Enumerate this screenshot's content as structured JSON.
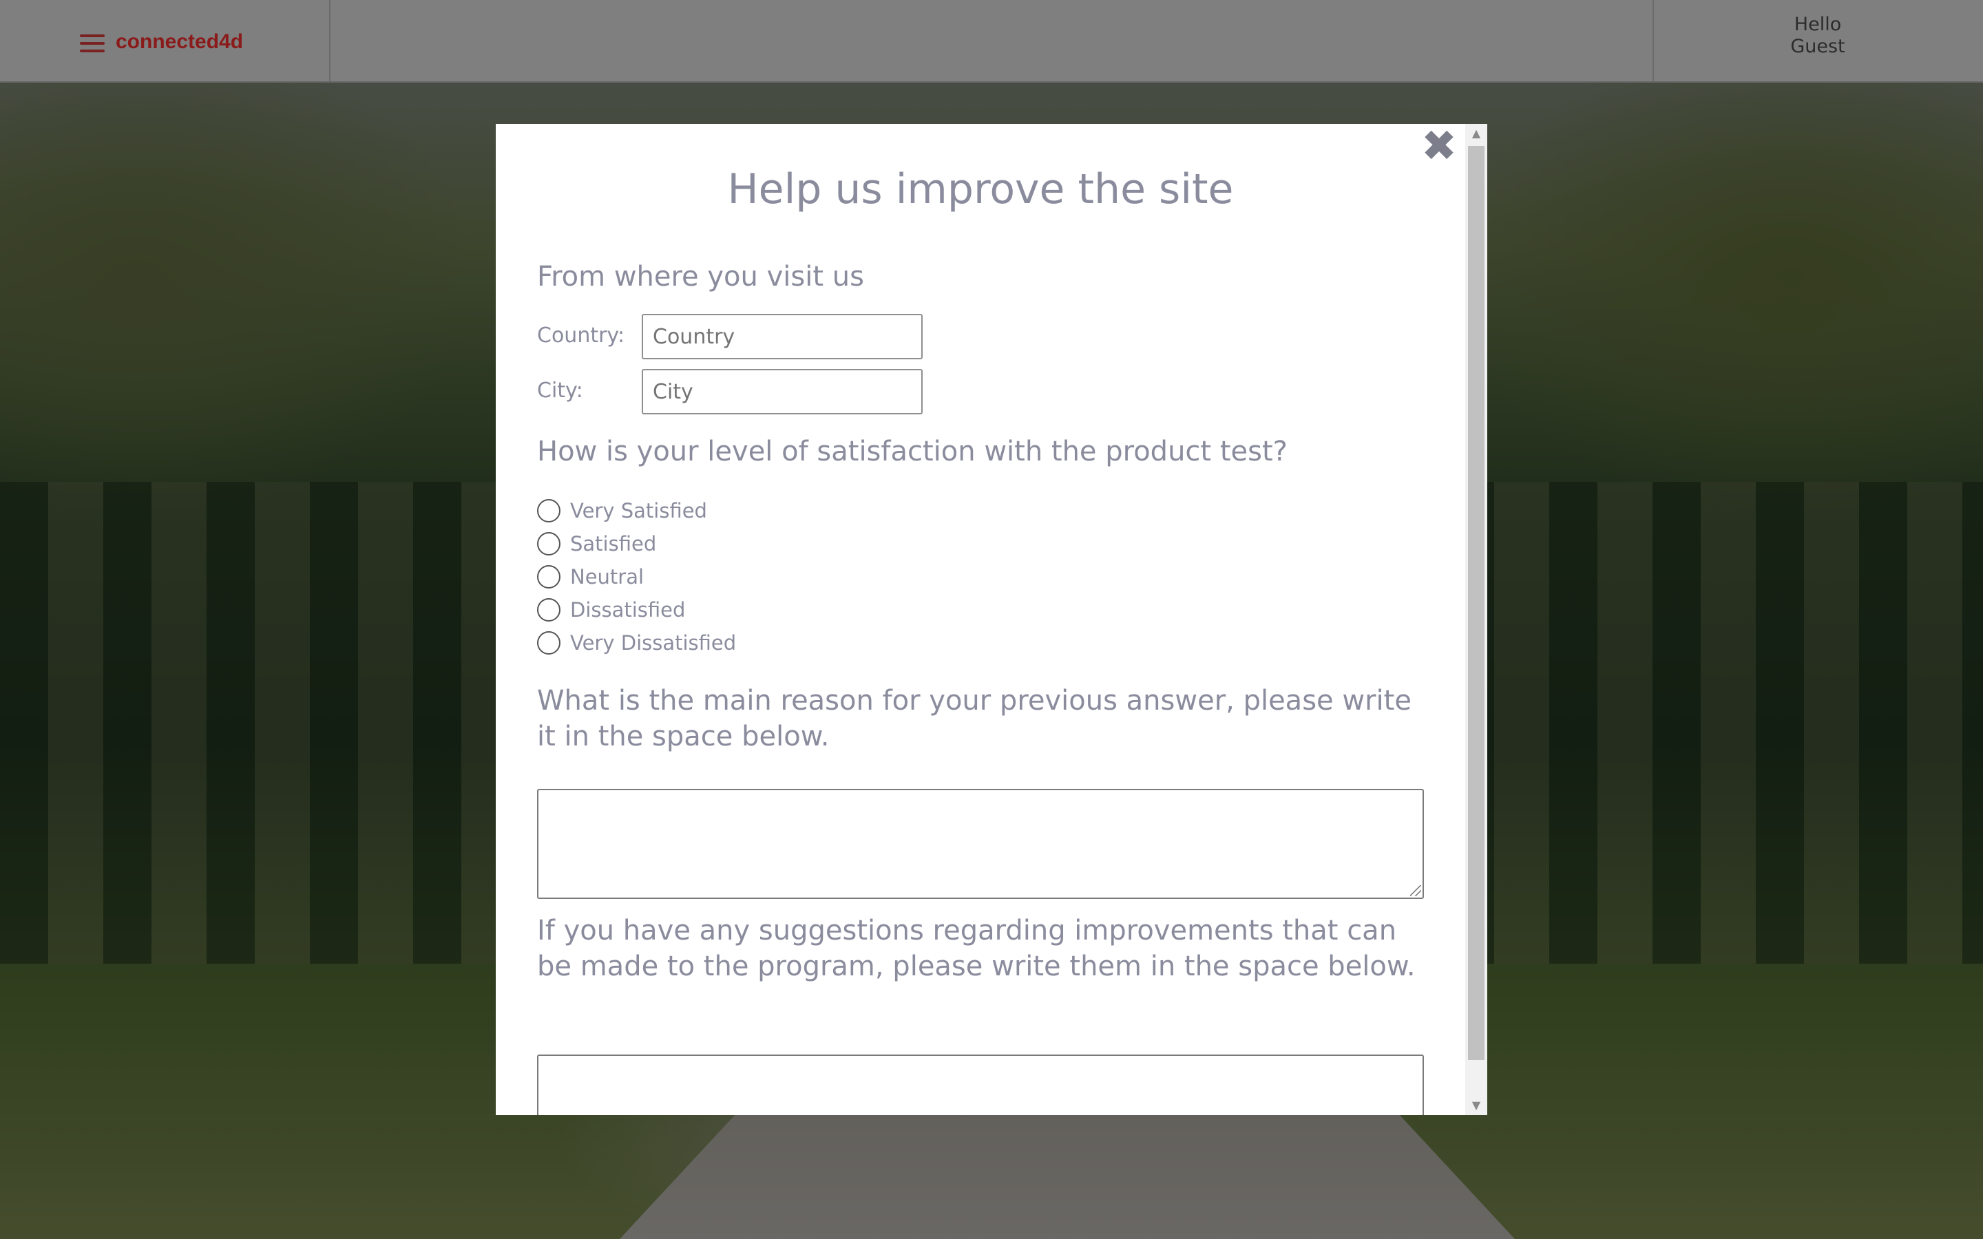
{
  "header": {
    "logo": "connected4d",
    "greeting_line1": "Hello",
    "greeting_line2": "Guest"
  },
  "modal": {
    "title": "Help us improve the site",
    "location_section": "From where you visit us",
    "country_label": "Country:",
    "country_placeholder": "Country",
    "city_label": "City:",
    "city_placeholder": "City",
    "satisfaction_question": "How is your level of satisfaction with the product test?",
    "options": [
      "Very Satisfied",
      "Satisfied",
      "Neutral",
      "Dissatisfied",
      "Very Dissatisfied"
    ],
    "reason_question": "What is the main reason for your previous answer, please write it in the space below.",
    "suggestions_question": "If you have any suggestions regarding improvements that can be made to the program, please write them in the space below.",
    "close_symbol": "✖"
  },
  "colors": {
    "text": "#8a8c9d",
    "logo": "#8b1a1a",
    "header_bg": "#7f7f7f"
  }
}
